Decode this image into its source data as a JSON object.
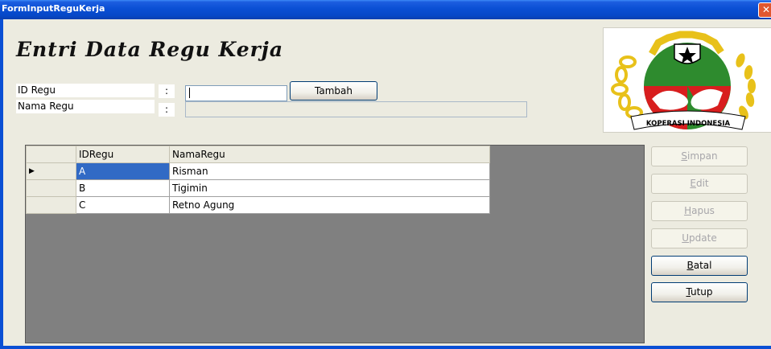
{
  "window": {
    "title": "FormInputReguKerja",
    "close_glyph": "✕"
  },
  "form": {
    "heading": "Entri Data Regu Kerja",
    "fields": [
      {
        "label": "ID Regu",
        "colon": ":",
        "value": ""
      },
      {
        "label": "Nama Regu",
        "colon": ":",
        "value": ""
      }
    ],
    "tambah_label": "Tambah"
  },
  "logo": {
    "text": "KOPERASI INDONESIA",
    "colors": {
      "green": "#2e8b2e",
      "red": "#d81e1e",
      "gold": "#e8c11a"
    }
  },
  "grid": {
    "columns": [
      "IDRegu",
      "NamaRegu"
    ],
    "rows": [
      {
        "id": "A",
        "nama": "Risman",
        "indicator": "▶"
      },
      {
        "id": "B",
        "nama": "Tigimin",
        "indicator": ""
      },
      {
        "id": "C",
        "nama": "Retno Agung",
        "indicator": ""
      }
    ]
  },
  "buttons": {
    "simpan": {
      "mnemonic": "S",
      "rest": "impan"
    },
    "edit": {
      "mnemonic": "E",
      "rest": "dit"
    },
    "hapus": {
      "mnemonic": "H",
      "rest": "apus"
    },
    "update": {
      "mnemonic": "U",
      "rest": "pdate"
    },
    "batal": {
      "mnemonic": "B",
      "rest": "atal"
    },
    "tutup": {
      "mnemonic": "T",
      "rest": "utup"
    }
  }
}
